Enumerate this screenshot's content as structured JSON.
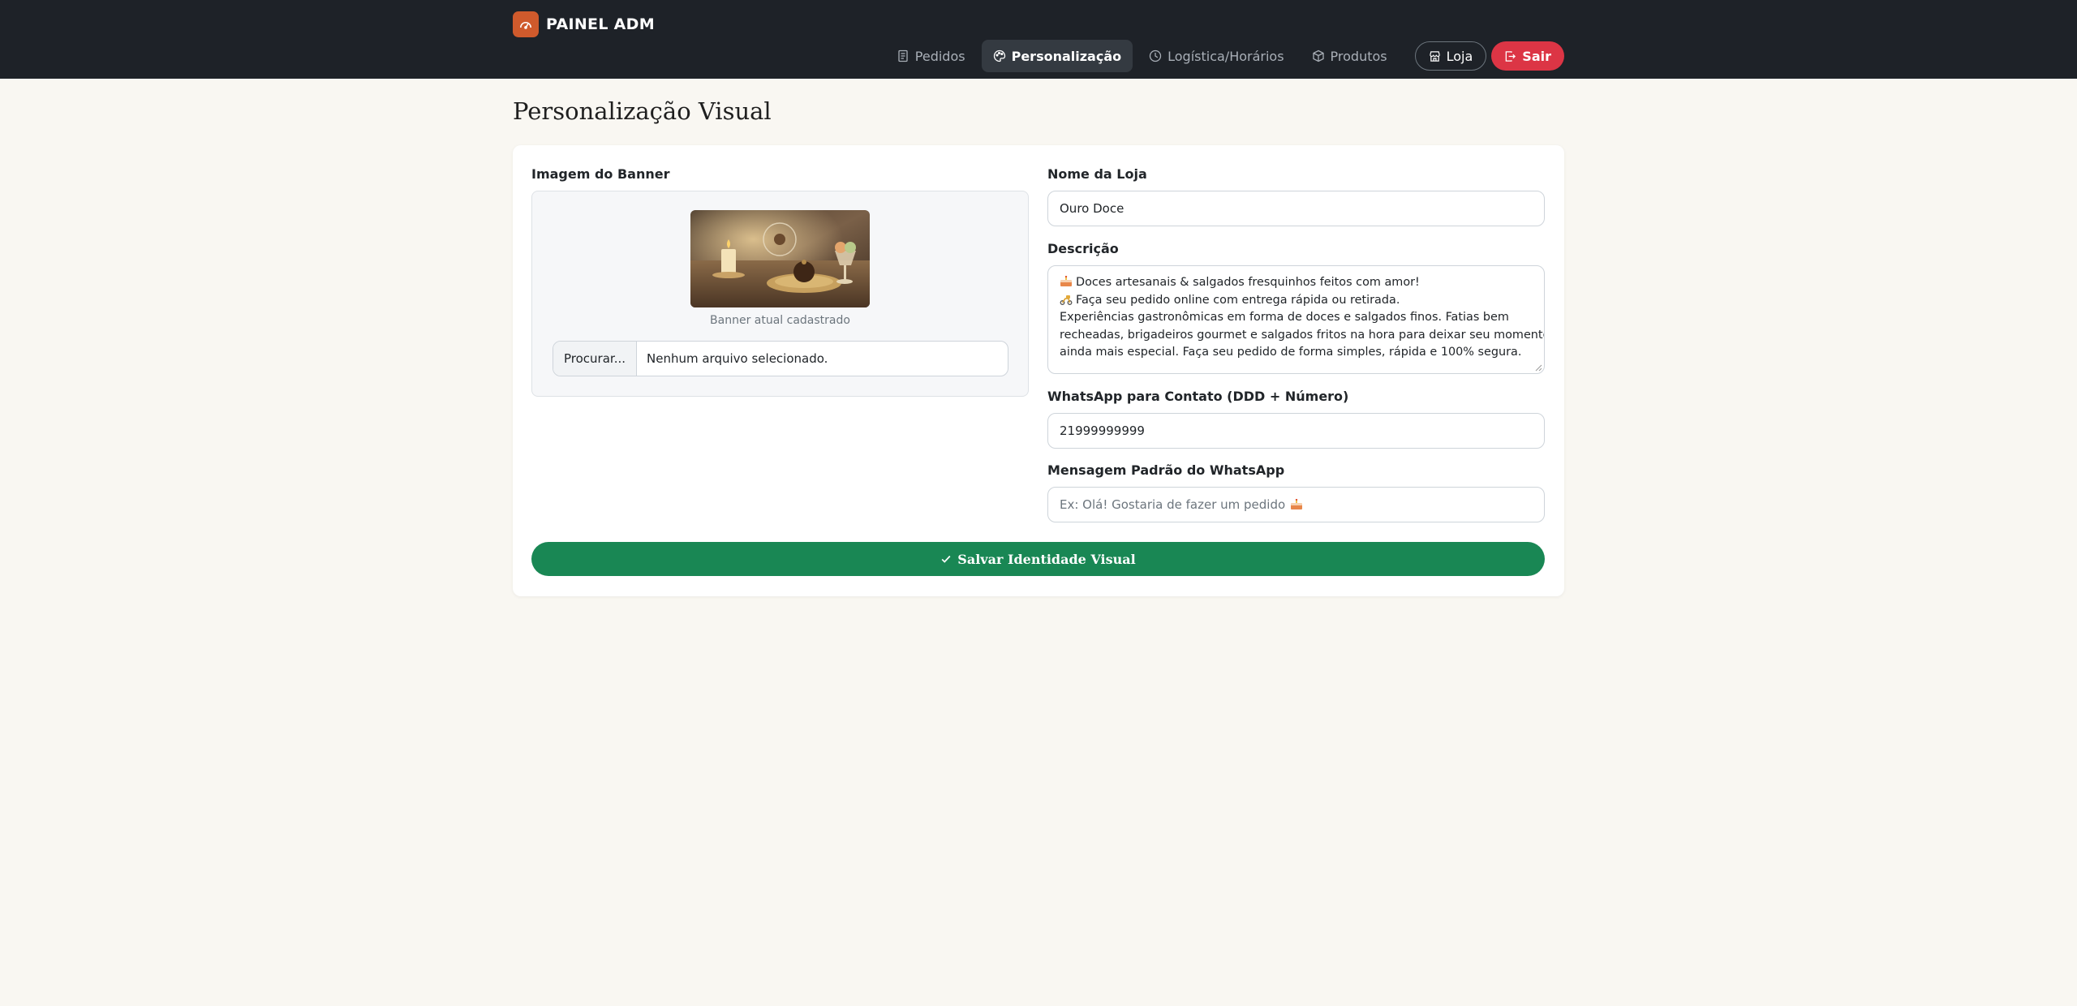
{
  "brand": {
    "title": "PAINEL ADM",
    "logo_icon": "dashboard-icon",
    "logo_color": "#cf5a2c"
  },
  "nav": {
    "items": [
      {
        "label": "Pedidos",
        "icon": "receipt-icon",
        "active": false
      },
      {
        "label": "Personalização",
        "icon": "palette-icon",
        "active": true
      },
      {
        "label": "Logística/Horários",
        "icon": "clock-icon",
        "active": false
      },
      {
        "label": "Produtos",
        "icon": "box-icon",
        "active": false
      }
    ],
    "store_button": "Loja",
    "logout_button": "Sair"
  },
  "page": {
    "title": "Personalização Visual"
  },
  "banner": {
    "label": "Imagem do Banner",
    "caption": "Banner atual cadastrado",
    "browse_label": "Procurar...",
    "file_status": "Nenhum arquivo selecionado."
  },
  "form": {
    "store_name_label": "Nome da Loja",
    "store_name_value": "Ouro Doce",
    "description_label": "Descrição",
    "description_lines": [
      "Doces artesanais & salgados fresquinhos feitos com amor!",
      "Faça seu pedido online com entrega rápida ou retirada.",
      "Experiências gastronômicas em forma de doces e salgados finos. Fatias bem",
      "recheadas, brigadeiros gourmet e salgados fritos na hora para deixar seu momento",
      "ainda mais especial. Faça seu pedido de forma simples, rápida e 100% segura."
    ],
    "whatsapp_label": "WhatsApp para Contato (DDD + Número)",
    "whatsapp_value": "21999999999",
    "message_label": "Mensagem Padrão do WhatsApp",
    "message_placeholder": "Ex: Olá! Gostaria de fazer um pedido"
  },
  "save_button": "Salvar Identidade Visual",
  "colors": {
    "navbar": "#1e2228",
    "background": "#f9f7f2",
    "success": "#198754",
    "danger": "#dc3545"
  }
}
